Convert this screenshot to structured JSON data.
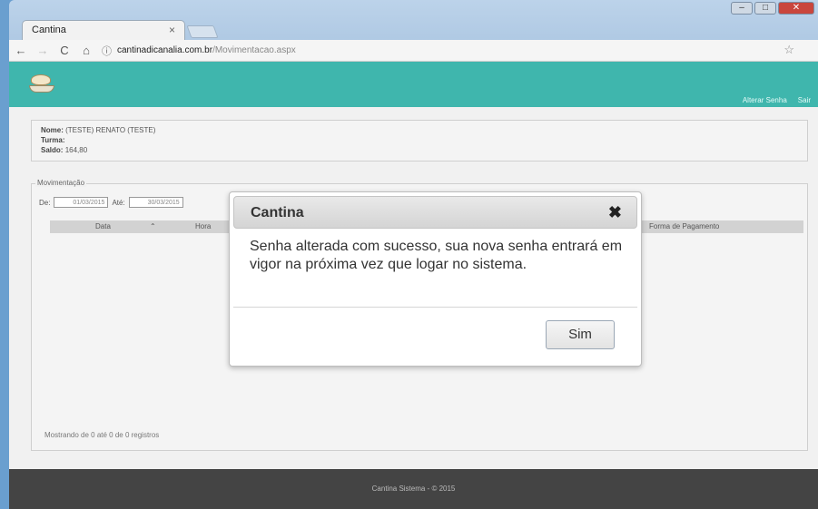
{
  "browser": {
    "tab_title": "Cantina",
    "tab_close": "×",
    "address_host": "cantinadicanalia.com.br",
    "address_path": "/Movimentacao.aspx",
    "back": "←",
    "forward": "→",
    "reload": "C",
    "home": "⌂",
    "info": "ⓘ",
    "star": "☆"
  },
  "header": {
    "links": [
      "Alterar Senha",
      "Sair"
    ]
  },
  "info": {
    "nome_label": "Nome:",
    "nome_value": "(TESTE) RENATO (TESTE)",
    "turma_label": "Turma:",
    "turma_value": "",
    "saldo_label": "Saldo:",
    "saldo_value": "164,80"
  },
  "movimentacao": {
    "legend": "Movimentação",
    "de_label": "De:",
    "de_value": "01/03/2015",
    "ate_label": "Até:",
    "ate_value": "30/03/2015",
    "columns": [
      "Data",
      "Hora",
      "Forma de Pagamento"
    ],
    "footer_note": "Mostrando de 0 até 0 de 0 registros"
  },
  "footer": {
    "text": "Cantina Sistema - © 2015"
  },
  "modal": {
    "title": "Cantina",
    "close": "✖",
    "message": "Senha alterada com sucesso, sua nova senha entrará em vigor na próxima vez que logar no sistema.",
    "confirm": "Sim"
  }
}
